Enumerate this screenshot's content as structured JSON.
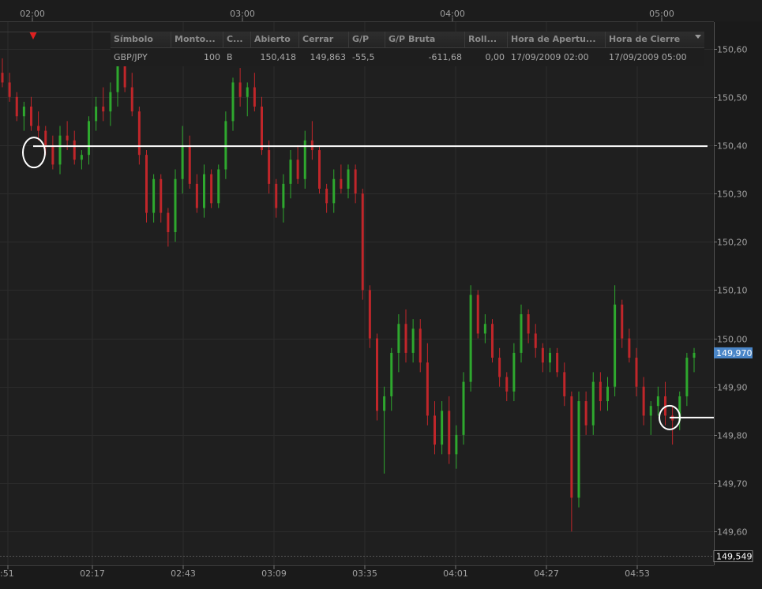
{
  "chart_data": {
    "type": "candlestick",
    "symbol": "GBP/JPY",
    "top_time_labels": [
      "02:00",
      "03:00",
      "04:00",
      "05:00"
    ],
    "bottom_time_labels": [
      ":51",
      "02:17",
      "02:43",
      "03:09",
      "03:35",
      "04:01",
      "04:27",
      "04:53"
    ],
    "price_ticks": [
      "150,60",
      "150,50",
      "150,40",
      "150,30",
      "150,20",
      "150,10",
      "150,00",
      "149,90",
      "149,80",
      "149,70",
      "149,60"
    ],
    "price_tick_values": [
      150.6,
      150.5,
      150.4,
      150.3,
      150.2,
      150.1,
      150.0,
      149.9,
      149.8,
      149.7,
      149.6
    ],
    "ylim": [
      149.53,
      150.655
    ],
    "current_price_label": "149,970",
    "current_price": 149.97,
    "low_price_label": "149,549",
    "low_price": 149.549,
    "open_price_line": 150.398,
    "close_price_line": 149.836,
    "up_color": "#2ea82e",
    "down_color": "#c0262a",
    "current_price_bg": "#4a86c8",
    "ohlc": [
      [
        150.55,
        150.58,
        150.52,
        150.53
      ],
      [
        150.53,
        150.55,
        150.49,
        150.5
      ],
      [
        150.5,
        150.51,
        150.45,
        150.46
      ],
      [
        150.46,
        150.49,
        150.43,
        150.48
      ],
      [
        150.48,
        150.5,
        150.43,
        150.44
      ],
      [
        150.44,
        150.47,
        150.41,
        150.43
      ],
      [
        150.43,
        150.44,
        150.38,
        150.4
      ],
      [
        150.4,
        150.42,
        150.35,
        150.36
      ],
      [
        150.36,
        150.44,
        150.34,
        150.42
      ],
      [
        150.42,
        150.45,
        150.39,
        150.41
      ],
      [
        150.41,
        150.43,
        150.36,
        150.37
      ],
      [
        150.37,
        150.39,
        150.35,
        150.38
      ],
      [
        150.38,
        150.46,
        150.36,
        150.45
      ],
      [
        150.45,
        150.5,
        150.43,
        150.48
      ],
      [
        150.48,
        150.52,
        150.45,
        150.47
      ],
      [
        150.47,
        150.53,
        150.44,
        150.51
      ],
      [
        150.51,
        150.59,
        150.48,
        150.57
      ],
      [
        150.57,
        150.61,
        150.51,
        150.52
      ],
      [
        150.52,
        150.55,
        150.46,
        150.47
      ],
      [
        150.47,
        150.48,
        150.36,
        150.38
      ],
      [
        150.38,
        150.39,
        150.24,
        150.26
      ],
      [
        150.26,
        150.34,
        150.24,
        150.33
      ],
      [
        150.33,
        150.34,
        150.24,
        150.26
      ],
      [
        150.26,
        150.27,
        150.19,
        150.22
      ],
      [
        150.22,
        150.35,
        150.2,
        150.33
      ],
      [
        150.33,
        150.44,
        150.3,
        150.4
      ],
      [
        150.4,
        150.42,
        150.31,
        150.32
      ],
      [
        150.32,
        150.34,
        150.26,
        150.27
      ],
      [
        150.27,
        150.36,
        150.25,
        150.34
      ],
      [
        150.34,
        150.35,
        150.27,
        150.28
      ],
      [
        150.28,
        150.36,
        150.27,
        150.35
      ],
      [
        150.35,
        150.47,
        150.33,
        150.45
      ],
      [
        150.45,
        150.54,
        150.43,
        150.53
      ],
      [
        150.53,
        150.56,
        150.48,
        150.5
      ],
      [
        150.5,
        150.53,
        150.46,
        150.52
      ],
      [
        150.52,
        150.55,
        150.47,
        150.48
      ],
      [
        150.48,
        150.5,
        150.38,
        150.39
      ],
      [
        150.39,
        150.41,
        150.3,
        150.32
      ],
      [
        150.32,
        150.33,
        150.25,
        150.27
      ],
      [
        150.27,
        150.34,
        150.24,
        150.32
      ],
      [
        150.32,
        150.39,
        150.29,
        150.37
      ],
      [
        150.37,
        150.4,
        150.32,
        150.33
      ],
      [
        150.33,
        150.43,
        150.31,
        150.41
      ],
      [
        150.41,
        150.45,
        150.37,
        150.39
      ],
      [
        150.39,
        150.4,
        150.3,
        150.31
      ],
      [
        150.31,
        150.32,
        150.26,
        150.28
      ],
      [
        150.28,
        150.35,
        150.26,
        150.33
      ],
      [
        150.33,
        150.36,
        150.3,
        150.31
      ],
      [
        150.31,
        150.36,
        150.29,
        150.35
      ],
      [
        150.35,
        150.36,
        150.28,
        150.3
      ],
      [
        150.3,
        150.31,
        150.08,
        150.1
      ],
      [
        150.1,
        150.11,
        149.98,
        150.0
      ],
      [
        150.0,
        150.01,
        149.83,
        149.85
      ],
      [
        149.85,
        149.9,
        149.72,
        149.88
      ],
      [
        149.88,
        149.98,
        149.85,
        149.97
      ],
      [
        149.97,
        150.05,
        149.93,
        150.03
      ],
      [
        150.03,
        150.06,
        149.95,
        149.97
      ],
      [
        149.97,
        150.04,
        149.95,
        150.02
      ],
      [
        150.02,
        150.04,
        149.93,
        149.95
      ],
      [
        149.95,
        149.99,
        149.82,
        149.84
      ],
      [
        149.84,
        149.87,
        149.76,
        149.78
      ],
      [
        149.78,
        149.87,
        149.76,
        149.85
      ],
      [
        149.85,
        149.88,
        149.74,
        149.76
      ],
      [
        149.76,
        149.82,
        149.73,
        149.8
      ],
      [
        149.8,
        149.93,
        149.78,
        149.91
      ],
      [
        149.91,
        150.11,
        149.89,
        150.09
      ],
      [
        150.09,
        150.1,
        150.0,
        150.01
      ],
      [
        150.01,
        150.05,
        149.99,
        150.03
      ],
      [
        150.03,
        150.04,
        149.95,
        149.96
      ],
      [
        149.96,
        149.98,
        149.9,
        149.92
      ],
      [
        149.92,
        149.93,
        149.87,
        149.89
      ],
      [
        149.89,
        149.99,
        149.87,
        149.97
      ],
      [
        149.97,
        150.07,
        149.95,
        150.05
      ],
      [
        150.05,
        150.06,
        149.99,
        150.01
      ],
      [
        150.01,
        150.03,
        149.96,
        149.98
      ],
      [
        149.98,
        149.99,
        149.93,
        149.95
      ],
      [
        149.95,
        149.98,
        149.93,
        149.97
      ],
      [
        149.97,
        149.98,
        149.92,
        149.93
      ],
      [
        149.93,
        149.95,
        149.86,
        149.88
      ],
      [
        149.88,
        149.89,
        149.6,
        149.67
      ],
      [
        149.67,
        149.89,
        149.65,
        149.87
      ],
      [
        149.87,
        149.89,
        149.8,
        149.82
      ],
      [
        149.82,
        149.93,
        149.8,
        149.91
      ],
      [
        149.91,
        149.93,
        149.85,
        149.87
      ],
      [
        149.87,
        149.92,
        149.85,
        149.9
      ],
      [
        149.9,
        150.11,
        149.88,
        150.07
      ],
      [
        150.07,
        150.08,
        149.98,
        150.0
      ],
      [
        150.0,
        150.02,
        149.95,
        149.96
      ],
      [
        149.96,
        149.98,
        149.88,
        149.9
      ],
      [
        149.9,
        149.92,
        149.82,
        149.84
      ],
      [
        149.84,
        149.87,
        149.8,
        149.86
      ],
      [
        149.86,
        149.9,
        149.84,
        149.88
      ],
      [
        149.88,
        149.91,
        149.82,
        149.84
      ],
      [
        149.84,
        149.86,
        149.78,
        149.83
      ],
      [
        149.83,
        149.89,
        149.81,
        149.88
      ],
      [
        149.88,
        149.97,
        149.86,
        149.96
      ],
      [
        149.96,
        149.98,
        149.93,
        149.97
      ]
    ]
  },
  "trade_table": {
    "headers": [
      "Símbolo",
      "Monto...",
      "C...",
      "Abierto",
      "Cerrar",
      "G/P",
      "G/P Bruta",
      "Roll...",
      "Hora de Apertu...",
      "Hora de Cierre"
    ],
    "row": [
      "GBP/JPY",
      "100",
      "B",
      "150,418",
      "149,863",
      "-55,5",
      "-611,68",
      "0,00",
      "17/09/2009 02:00",
      "17/09/2009 05:00"
    ]
  }
}
